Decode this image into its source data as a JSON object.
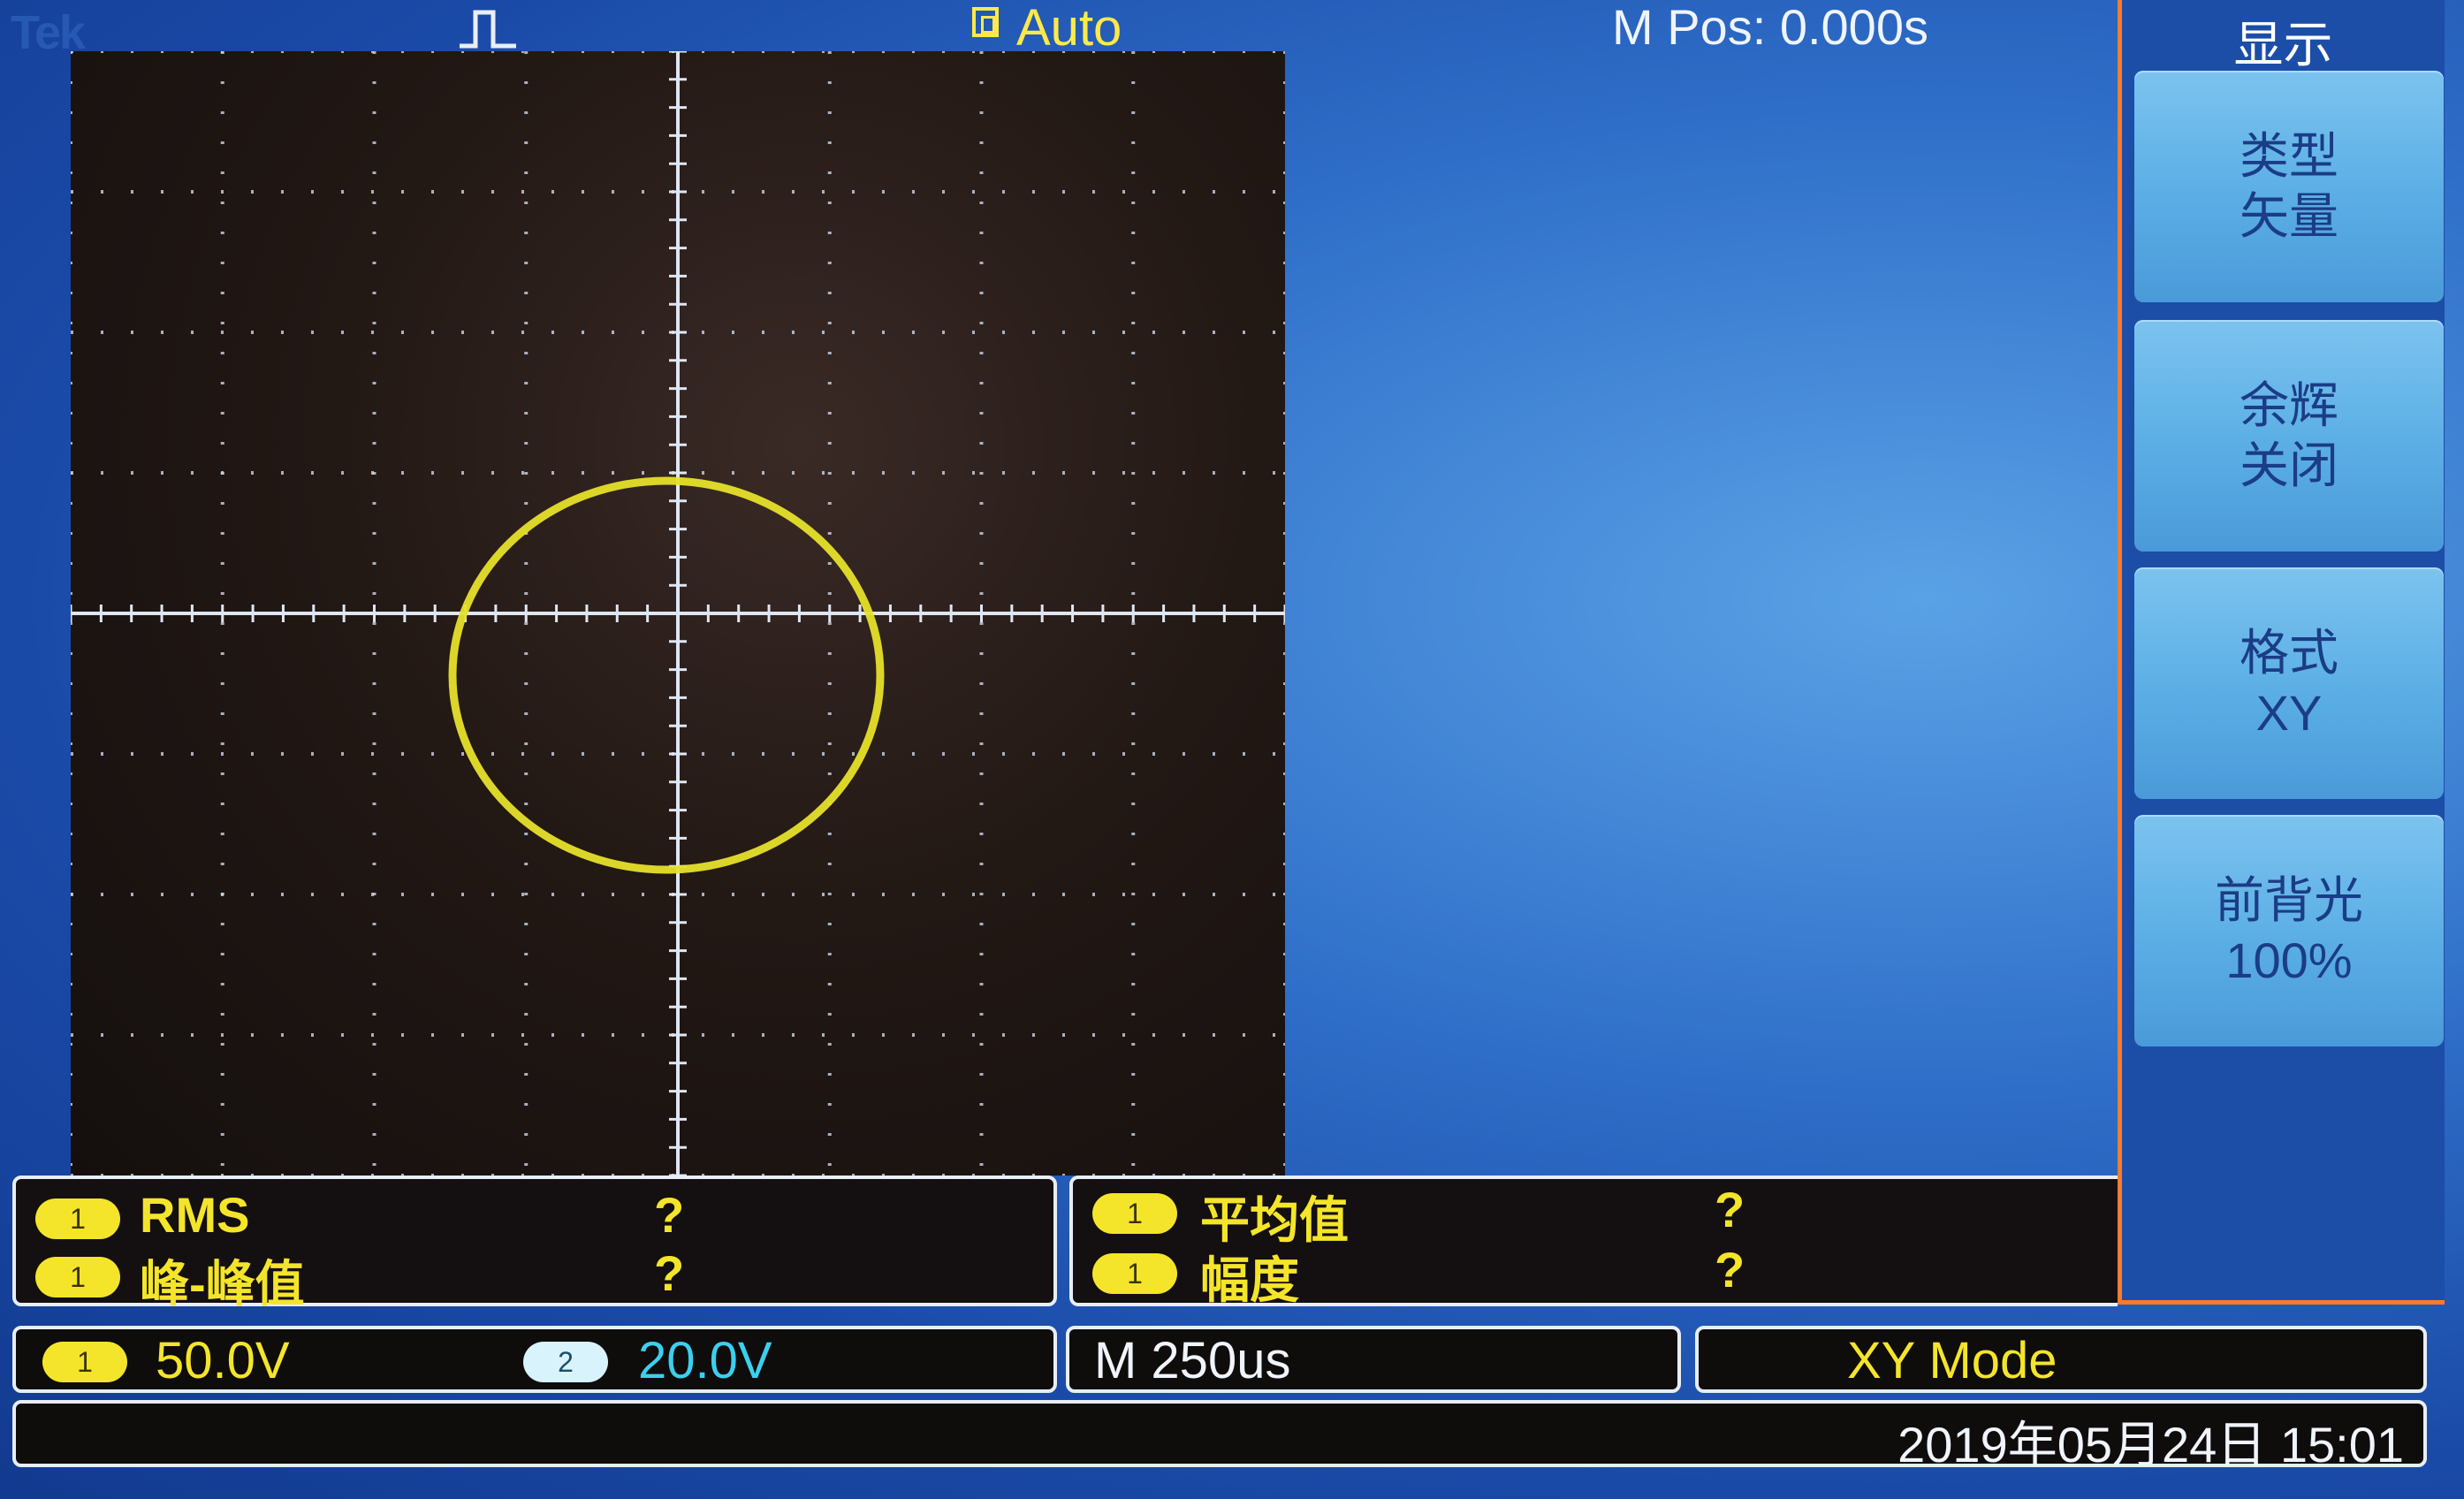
{
  "top": {
    "logo": "Tek",
    "trigger_icon": "trigger-pulse-icon",
    "acq_mode": "Auto",
    "m_pos": "M Pos: 0.000s"
  },
  "menu": {
    "title": "显示",
    "buttons": [
      {
        "line1": "类型",
        "line2": "矢量"
      },
      {
        "line1": "余辉",
        "line2": "关闭"
      },
      {
        "line1": "格式",
        "line2": "XY"
      },
      {
        "line1": "前背光",
        "line2": "100%"
      }
    ]
  },
  "measurements": {
    "left": [
      {
        "channel": "1",
        "label": "RMS",
        "value": "?"
      },
      {
        "channel": "1",
        "label": "峰-峰值",
        "value": "?"
      }
    ],
    "right": [
      {
        "channel": "1",
        "label": "平均值",
        "value": "?"
      },
      {
        "channel": "1",
        "label": "幅度",
        "value": "?"
      }
    ]
  },
  "status": {
    "ch1_badge": "1",
    "ch1_scale": "50.0V",
    "ch2_badge": "2",
    "ch2_scale": "20.0V",
    "timebase": "M 250us",
    "mode": "XY Mode",
    "datetime": "2019年05月24日 15:01"
  },
  "colors": {
    "trace": "#e6e02a",
    "channel1": "#f4e52a",
    "channel2": "#3ad0ee",
    "menu_accent": "#ff7a2a"
  }
}
